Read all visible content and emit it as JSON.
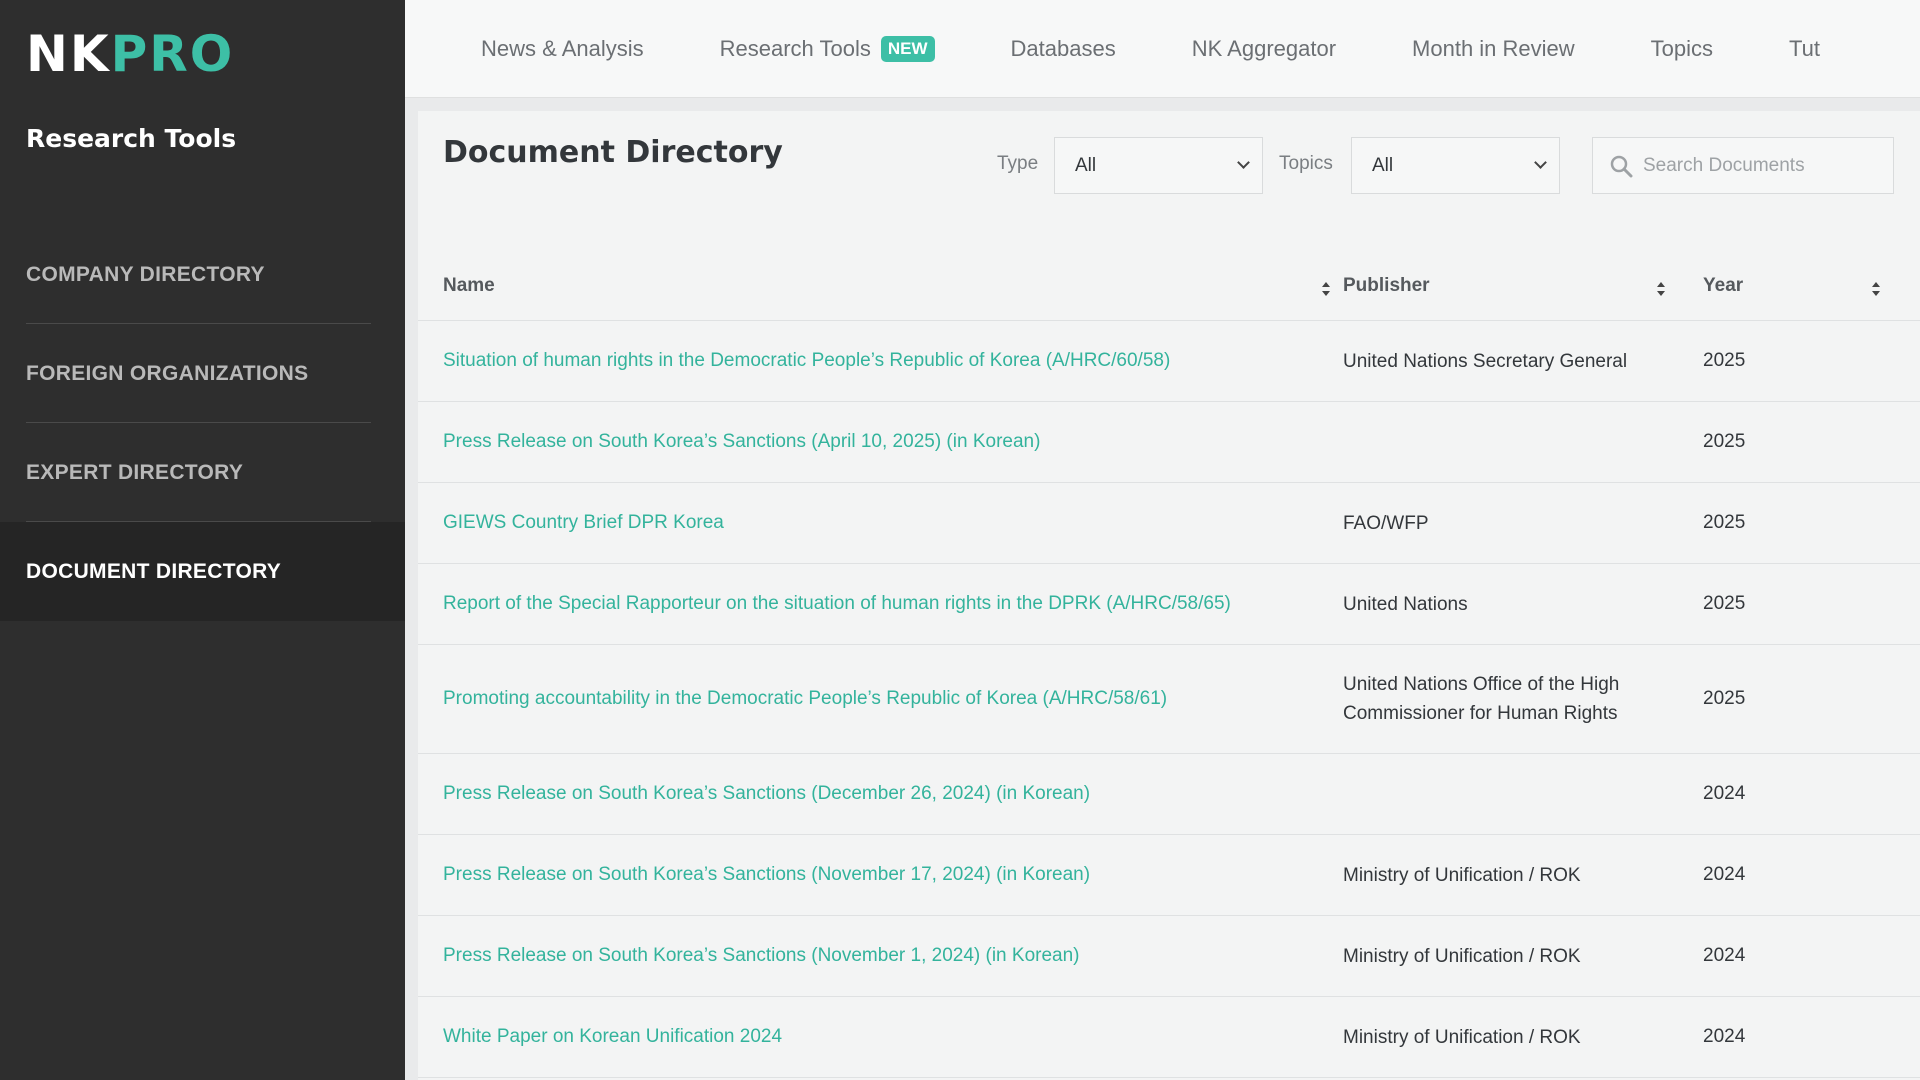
{
  "sidebar": {
    "logo_nk": "NK",
    "logo_pro": "PRO",
    "section_title": "Research Tools",
    "items": [
      {
        "label": "COMPANY DIRECTORY"
      },
      {
        "label": "FOREIGN ORGANIZATIONS"
      },
      {
        "label": "EXPERT DIRECTORY"
      },
      {
        "label": "DOCUMENT DIRECTORY"
      }
    ],
    "active_item": "DOCUMENT DIRECTORY"
  },
  "topnav": {
    "items": [
      {
        "label": "News & Analysis"
      },
      {
        "label": "Research Tools",
        "badge": "NEW"
      },
      {
        "label": "Databases"
      },
      {
        "label": "NK Aggregator"
      },
      {
        "label": "Month in Review"
      },
      {
        "label": "Topics"
      },
      {
        "label": "Tut"
      }
    ]
  },
  "main": {
    "title": "Document Directory",
    "filters": {
      "type_label": "Type",
      "type_value": "All",
      "topics_label": "Topics",
      "topics_value": "All",
      "search_placeholder": "Search Documents"
    },
    "table": {
      "columns": [
        "Name",
        "Publisher",
        "Year"
      ],
      "rows": [
        {
          "name": "Situation of human rights in the Democratic People’s Republic of Korea (A/HRC/60/58)",
          "publisher": "United Nations Secretary General",
          "year": "2025"
        },
        {
          "name": "Press Release on South Korea’s Sanctions (April 10, 2025) (in Korean)",
          "publisher": "",
          "year": "2025"
        },
        {
          "name": "GIEWS Country Brief DPR Korea",
          "publisher": "FAO/WFP",
          "year": "2025"
        },
        {
          "name": "Report of the Special Rapporteur on the situation of human rights in the DPRK (A/HRC/58/65)",
          "publisher": "United Nations",
          "year": "2025"
        },
        {
          "name": "Promoting accountability in the Democratic People’s Republic of Korea (A/HRC/58/61)",
          "publisher": "United Nations Office of the High Commissioner for Human Rights",
          "year": "2025"
        },
        {
          "name": "Press Release on South Korea’s Sanctions (December 26, 2024) (in Korean)",
          "publisher": "",
          "year": "2024"
        },
        {
          "name": "Press Release on South Korea’s Sanctions (November 17, 2024) (in Korean)",
          "publisher": "Ministry of Unification / ROK",
          "year": "2024"
        },
        {
          "name": "Press Release on South Korea’s Sanctions (November 1, 2024) (in Korean)",
          "publisher": "Ministry of Unification / ROK",
          "year": "2024"
        },
        {
          "name": "White Paper on Korean Unification 2024",
          "publisher": "Ministry of Unification / ROK",
          "year": "2024"
        }
      ]
    }
  },
  "colors": {
    "accent": "#3dbfa6",
    "link": "#33b39c",
    "sidebar_bg": "#2e2e2e",
    "sidebar_active_bg": "#252525"
  }
}
